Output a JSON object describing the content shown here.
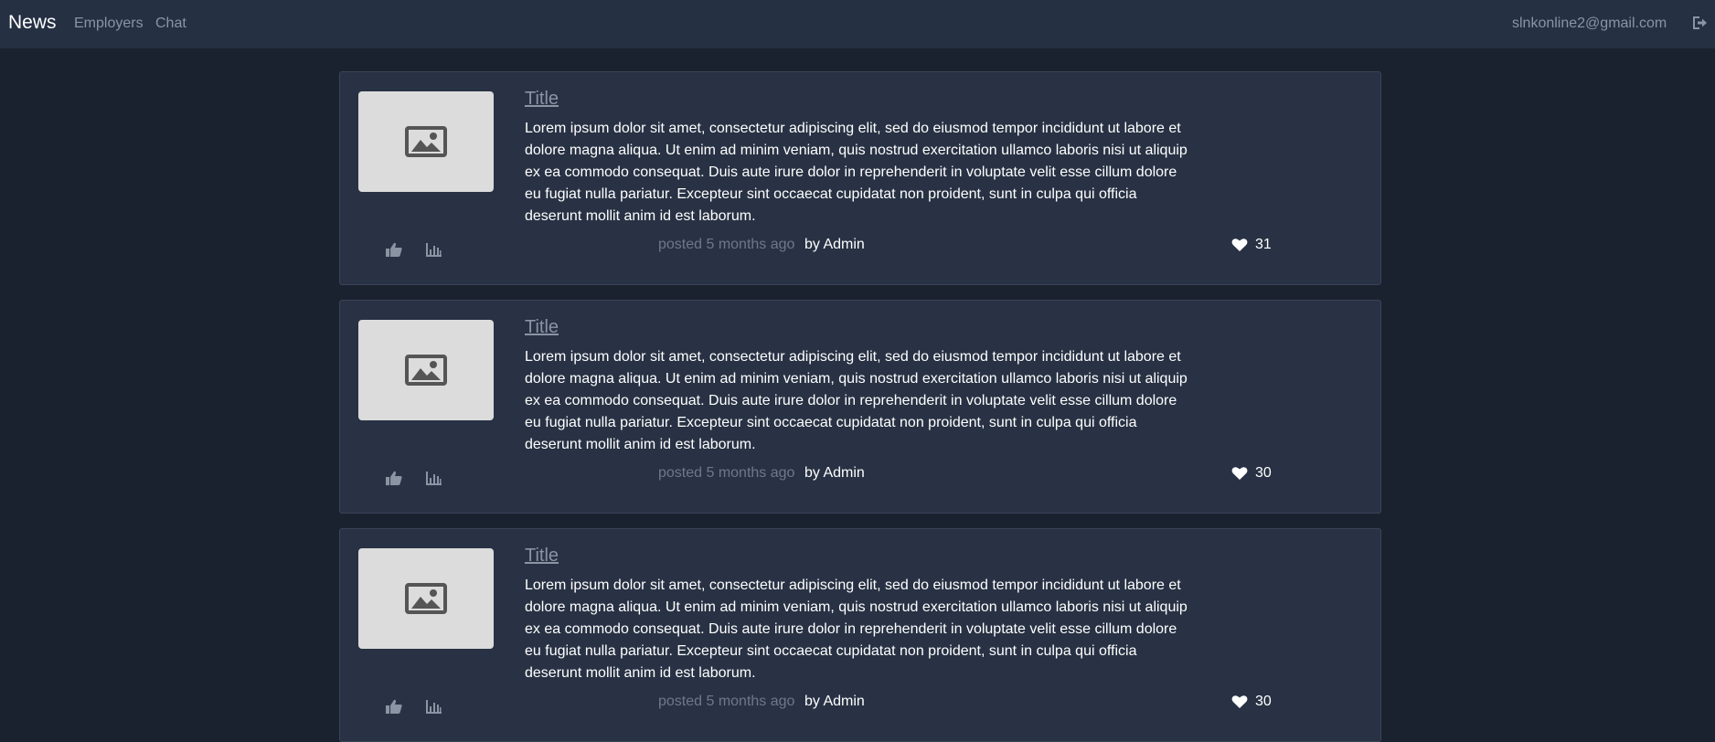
{
  "navbar": {
    "brand": "News",
    "links": [
      "Employers",
      "Chat"
    ],
    "email": "slnkonline2@gmail.com",
    "logout_icon": "sign-out-icon"
  },
  "posts": [
    {
      "title": "Title",
      "body": "Lorem ipsum dolor sit amet, consectetur adipiscing elit, sed do eiusmod tempor incididunt ut labore et dolore magna aliqua. Ut enim ad minim veniam, quis nostrud exercitation ullamco laboris nisi ut aliquip ex ea commodo consequat. Duis aute irure dolor in reprehenderit in voluptate velit esse cillum dolore eu fugiat nulla pariatur. Excepteur sint occaecat cupidatat non proident, sunt in culpa qui officia deserunt mollit anim id est laborum.",
      "posted": "posted 5 months ago",
      "author": "by Admin",
      "likes": "31"
    },
    {
      "title": "Title",
      "body": "Lorem ipsum dolor sit amet, consectetur adipiscing elit, sed do eiusmod tempor incididunt ut labore et dolore magna aliqua. Ut enim ad minim veniam, quis nostrud exercitation ullamco laboris nisi ut aliquip ex ea commodo consequat. Duis aute irure dolor in reprehenderit in voluptate velit esse cillum dolore eu fugiat nulla pariatur. Excepteur sint occaecat cupidatat non proident, sunt in culpa qui officia deserunt mollit anim id est laborum.",
      "posted": "posted 5 months ago",
      "author": "by Admin",
      "likes": "30"
    },
    {
      "title": "Title",
      "body": "Lorem ipsum dolor sit amet, consectetur adipiscing elit, sed do eiusmod tempor incididunt ut labore et dolore magna aliqua. Ut enim ad minim veniam, quis nostrud exercitation ullamco laboris nisi ut aliquip ex ea commodo consequat. Duis aute irure dolor in reprehenderit in voluptate velit esse cillum dolore eu fugiat nulla pariatur. Excepteur sint occaecat cupidatat non proident, sunt in culpa qui officia deserunt mollit anim id est laborum.",
      "posted": "posted 5 months ago",
      "author": "by Admin",
      "likes": "30"
    }
  ],
  "colors": {
    "page_bg": "#1a2230",
    "navbar_bg": "#253043",
    "card_bg": "#283244",
    "muted_text": "#8a94a3",
    "thumbnail_bg": "#dcdcdc"
  },
  "icons": {
    "thumbnail": "image-icon",
    "like_action": "thumbs-up-icon",
    "stats_action": "bar-chart-icon",
    "likes": "heart-icon"
  }
}
